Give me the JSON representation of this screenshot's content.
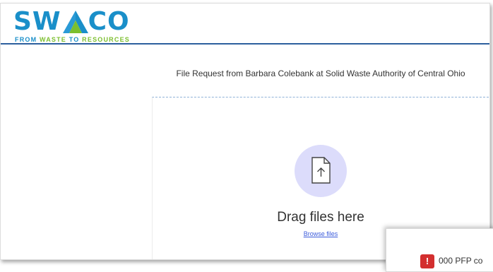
{
  "brand": {
    "logo_word": "SWACO",
    "tagline_from": "FROM",
    "tagline_waste": "WASTE",
    "tagline_to": "TO",
    "tagline_resources": "RESOURCES",
    "colors": {
      "blue": "#1a8fc9",
      "green": "#7cbf2f",
      "header_rule": "#2c5f9e"
    }
  },
  "main": {
    "request_title": "File Request from Barbara Colebank at Solid Waste Authority of Central Ohio",
    "upload_icon": "file-upload-icon",
    "drag_text": "Drag files here",
    "browse_link": "Browse files"
  },
  "popup": {
    "icon": "alert-icon",
    "icon_glyph": "!",
    "text": "000 PFP co"
  }
}
